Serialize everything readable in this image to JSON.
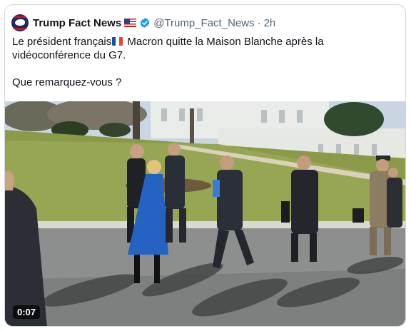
{
  "tweet": {
    "author_name": "Trump Fact News",
    "author_flag_icon": "us-flag-icon",
    "verified_icon": "verified-badge-icon",
    "handle": "@Trump_Fact_News",
    "separator": "·",
    "time": "2h",
    "text_line1_a": "Le président français",
    "text_flag_icon": "france-flag-icon",
    "text_line1_b": " Macron quitte la Maison Blanche après la",
    "text_line2": "vidéoconférence du G7.",
    "text_line3": "Que remarquez-vous ?"
  },
  "media": {
    "type": "video",
    "duration": "0:07"
  },
  "colors": {
    "text": "#0f1419",
    "secondary": "#536471",
    "verified": "#1d9bf0",
    "border": "#cfd9de"
  }
}
